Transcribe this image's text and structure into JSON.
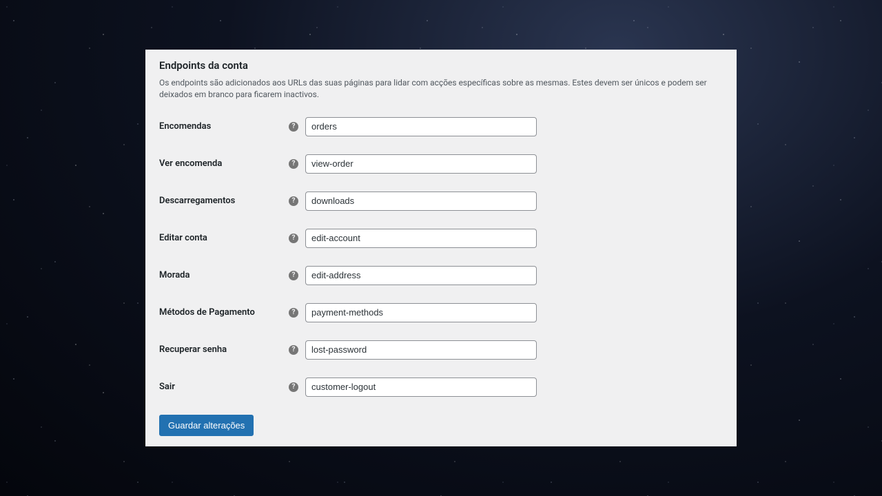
{
  "section": {
    "title": "Endpoints da conta",
    "description": "Os endpoints são adicionados aos URLs das suas páginas para lidar com acções específicas sobre as mesmas. Estes devem ser únicos e podem ser deixados em branco para ficarem inactivos."
  },
  "help_glyph": "?",
  "fields": {
    "orders": {
      "label": "Encomendas",
      "value": "orders"
    },
    "view_order": {
      "label": "Ver encomenda",
      "value": "view-order"
    },
    "downloads": {
      "label": "Descarregamentos",
      "value": "downloads"
    },
    "edit_account": {
      "label": "Editar conta",
      "value": "edit-account"
    },
    "edit_address": {
      "label": "Morada",
      "value": "edit-address"
    },
    "payment_methods": {
      "label": "Métodos de Pagamento",
      "value": "payment-methods"
    },
    "lost_password": {
      "label": "Recuperar senha",
      "value": "lost-password"
    },
    "logout": {
      "label": "Sair",
      "value": "customer-logout"
    }
  },
  "actions": {
    "save_label": "Guardar alterações"
  }
}
